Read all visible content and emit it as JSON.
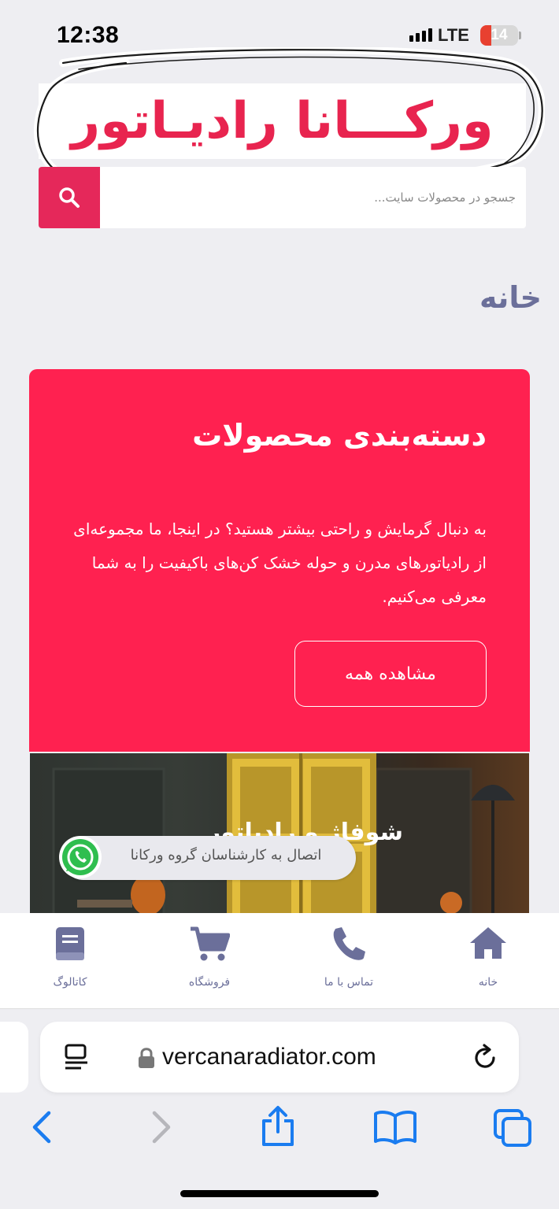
{
  "status_bar": {
    "time": "12:38",
    "network": "LTE",
    "battery": "14"
  },
  "site": {
    "logo_text": "ورکـــانا رادیـاتور",
    "search": {
      "placeholder": "جسجو در محصولات سایت..."
    },
    "page_title": "خانه"
  },
  "category_card": {
    "title": "دسته‌بندی محصولات",
    "description": "به دنبال گرمایش و راحتی بیشتر هستید؟ در اینجا، ما مجموعه‌ای از رادیاتورهای مدرن و حوله خشک کن‌های باکیفیت را به شما معرفی می‌کنیم.",
    "button_label": "مشاهده همه"
  },
  "product": {
    "caption": "شوفاژ و رادیاتور"
  },
  "whatsapp": {
    "label": "اتصال به کارشناسان گروه ورکانا"
  },
  "bottom_nav": {
    "items": [
      {
        "label": "خانه",
        "icon": "home-icon"
      },
      {
        "label": "تماس با ما",
        "icon": "phone-icon"
      },
      {
        "label": "فروشگاه",
        "icon": "cart-icon"
      },
      {
        "label": "کاتالوگ",
        "icon": "book-icon"
      }
    ],
    "color": "#6b6f9a"
  },
  "browser": {
    "url": "vercanaradiator.com",
    "accent": "#1a7cf0"
  },
  "colors": {
    "brand": "#ff2150",
    "search_button": "#e5285a"
  }
}
